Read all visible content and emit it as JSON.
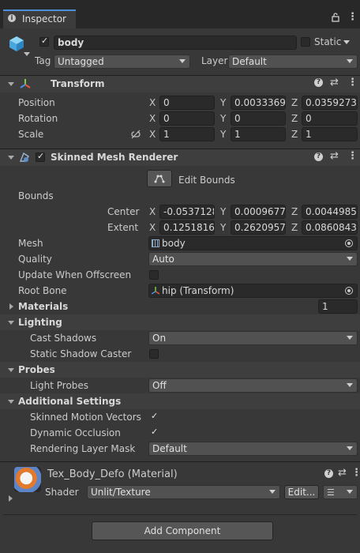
{
  "window": {
    "tab_label": "Inspector"
  },
  "object": {
    "name": "body",
    "static_label": "Static",
    "tag_label": "Tag",
    "tag_value": "Untagged",
    "layer_label": "Layer",
    "layer_value": "Default"
  },
  "transform": {
    "title": "Transform",
    "rows": [
      {
        "label": "Position",
        "x": "0",
        "y": "0.0033369",
        "z": "0.0359273"
      },
      {
        "label": "Rotation",
        "x": "0",
        "y": "0",
        "z": "0"
      },
      {
        "label": "Scale",
        "x": "1",
        "y": "1",
        "z": "1"
      }
    ],
    "axes": [
      "X",
      "Y",
      "Z"
    ]
  },
  "renderer": {
    "title": "Skinned Mesh Renderer",
    "edit_bounds": "Edit Bounds",
    "bounds_label": "Bounds",
    "center_label": "Center",
    "center": {
      "x": "-0.0537128",
      "y": "0.0009677",
      "z": "0.0044985"
    },
    "extent_label": "Extent",
    "extent": {
      "x": "0.1251816",
      "y": "0.2620957",
      "z": "0.0860843"
    },
    "mesh_label": "Mesh",
    "mesh_value": "body",
    "quality_label": "Quality",
    "quality_value": "Auto",
    "update_offscreen_label": "Update When Offscreen",
    "root_bone_label": "Root Bone",
    "root_bone_value": "hip (Transform)",
    "materials_label": "Materials",
    "materials_count": "1",
    "lighting_label": "Lighting",
    "cast_shadows_label": "Cast Shadows",
    "cast_shadows_value": "On",
    "static_shadow_label": "Static Shadow Caster",
    "probes_label": "Probes",
    "light_probes_label": "Light Probes",
    "light_probes_value": "Off",
    "additional_label": "Additional Settings",
    "motion_vectors_label": "Skinned Motion Vectors",
    "dynamic_occlusion_label": "Dynamic Occlusion",
    "rendering_layer_label": "Rendering Layer Mask",
    "rendering_layer_value": "Default"
  },
  "material": {
    "name": "Tex_Body_Defo (Material)",
    "shader_label": "Shader",
    "shader_value": "Unlit/Texture",
    "edit_label": "Edit..."
  },
  "footer": {
    "add_component": "Add Component"
  }
}
